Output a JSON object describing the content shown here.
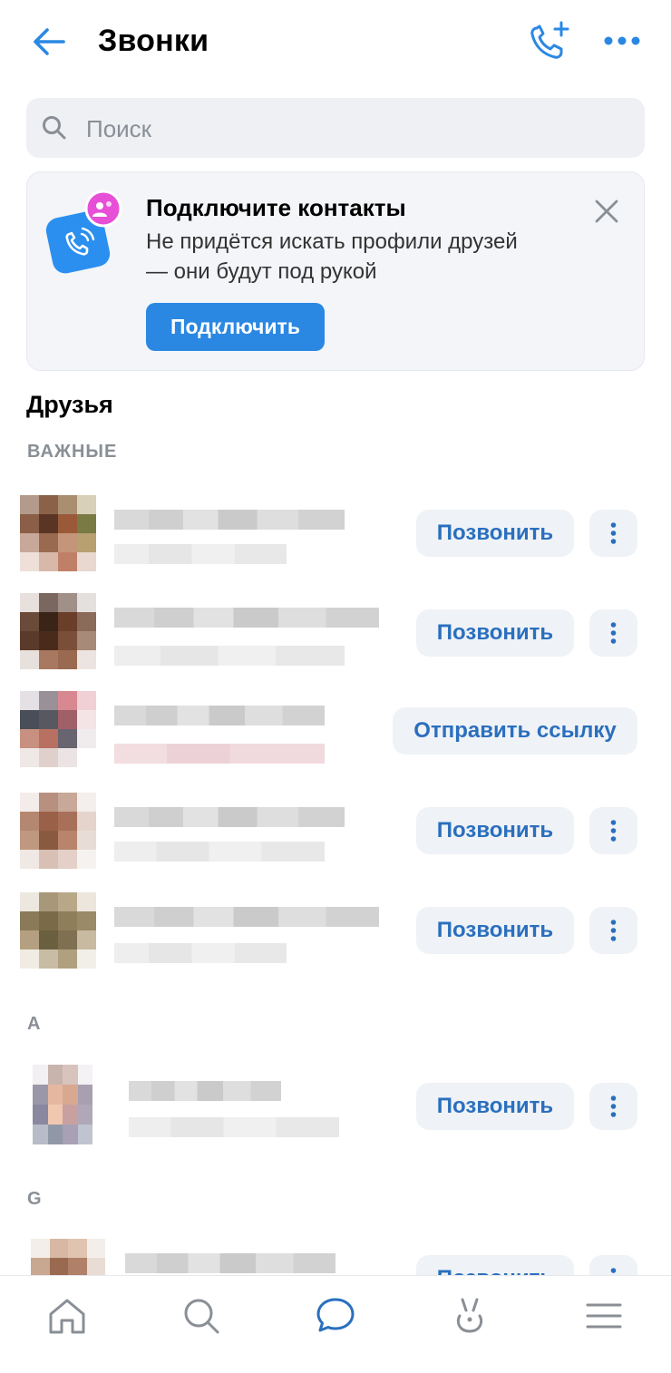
{
  "header": {
    "title": "Звонки",
    "back_icon": "arrow-left-icon",
    "call_add_icon": "phone-plus-icon",
    "more_icon": "more-horizontal-icon"
  },
  "search": {
    "placeholder": "Поиск"
  },
  "banner": {
    "title": "Подключите контакты",
    "text": "Не придётся искать профили друзей — они будут под рукой",
    "button": "Подключить"
  },
  "friends": {
    "title": "Друзья",
    "important_label": "ВАЖНЫЕ",
    "letter_a": "A",
    "letter_g": "G"
  },
  "contacts": [
    {
      "action": "Позвонить"
    },
    {
      "action": "Позвонить"
    },
    {
      "action": "Отправить ссылку"
    },
    {
      "action": "Позвонить"
    },
    {
      "action": "Позвонить"
    },
    {
      "action": "Позвонить"
    },
    {
      "action": "Позвонить"
    }
  ],
  "tabbar": [
    "home-icon",
    "search-icon",
    "messages-icon",
    "clips-icon",
    "menu-icon"
  ],
  "colors": {
    "accent": "#2a88e3",
    "link": "#2a6fbe",
    "secondary": "#eff2f6"
  }
}
